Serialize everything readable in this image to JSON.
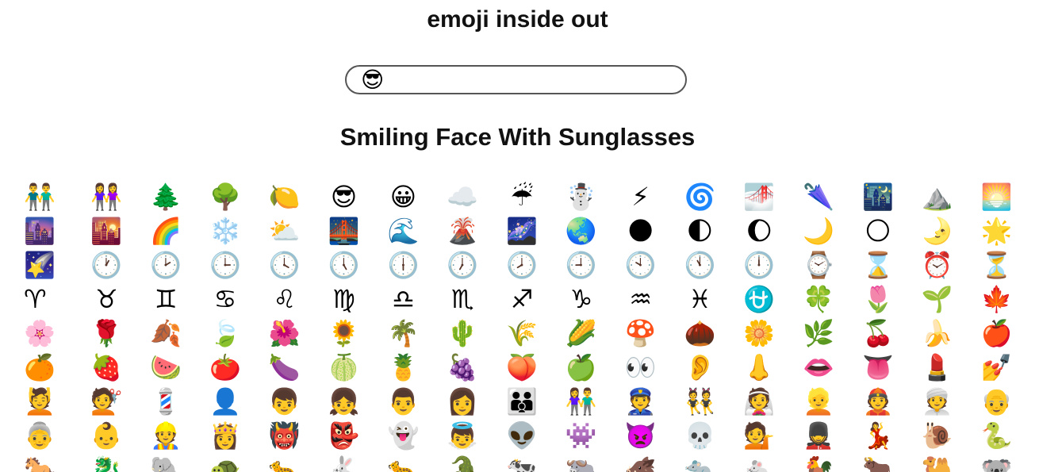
{
  "app": {
    "title": "emoji inside out"
  },
  "search": {
    "value": "😎"
  },
  "selected": {
    "name": "Smiling Face With Sunglasses"
  },
  "grid": {
    "rows": [
      [
        "👬",
        "👭",
        "🌲",
        "🌳",
        "🍋",
        "😎",
        "😀",
        "☁️",
        "☔",
        "☃️",
        "⚡",
        "🌀",
        "🌁",
        "🌂",
        "🌃",
        "⛰️",
        "🌅"
      ],
      [
        "🌆",
        "🌇",
        "🌈",
        "❄️",
        "⛅",
        "🌉",
        "🌊",
        "🌋",
        "🌌",
        "🌏",
        "🌑",
        "🌓",
        "🌔",
        "🌙",
        "🌕",
        "🌛",
        "🌟"
      ],
      [
        "🌠",
        "🕐",
        "🕑",
        "🕒",
        "🕓",
        "🕔",
        "🕕",
        "🕖",
        "🕗",
        "🕘",
        "🕙",
        "🕚",
        "🕛",
        "⌚",
        "⌛",
        "⏰",
        "⏳"
      ],
      [
        "♈",
        "♉",
        "♊",
        "♋",
        "♌",
        "♍",
        "♎",
        "♏",
        "♐",
        "♑",
        "♒",
        "♓",
        "⛎",
        "🍀",
        "🌷",
        "🌱",
        "🍁"
      ],
      [
        "🌸",
        "🌹",
        "🍂",
        "🍃",
        "🌺",
        "🌻",
        "🌴",
        "🌵",
        "🌾",
        "🌽",
        "🍄",
        "🌰",
        "🌼",
        "🌿",
        "🍒",
        "🍌",
        "🍎"
      ],
      [
        "🍊",
        "🍓",
        "🍉",
        "🍅",
        "🍆",
        "🍈",
        "🍍",
        "🍇",
        "🍑",
        "🍏",
        "👀",
        "👂",
        "👃",
        "👄",
        "👅",
        "💄",
        "💅"
      ],
      [
        "💆",
        "💇",
        "💈",
        "👤",
        "👦",
        "👧",
        "👨",
        "👩",
        "👪",
        "👫",
        "👮",
        "👯",
        "👰",
        "👱",
        "👲",
        "👳",
        "👴"
      ],
      [
        "👵",
        "👶",
        "👷",
        "👸",
        "👹",
        "👺",
        "👻",
        "👼",
        "👽",
        "👾",
        "👿",
        "💀",
        "💁",
        "💂",
        "💃",
        "🐌",
        "🐍"
      ],
      [
        "🐎",
        "🐉",
        "🐘",
        "🐢",
        "🐆",
        "🐇",
        "🐆",
        "🐊",
        "🐄",
        "🐃",
        "🐗",
        "🐀",
        "🐁",
        "🐓",
        "🐂",
        "🐫",
        "🐨"
      ]
    ]
  }
}
